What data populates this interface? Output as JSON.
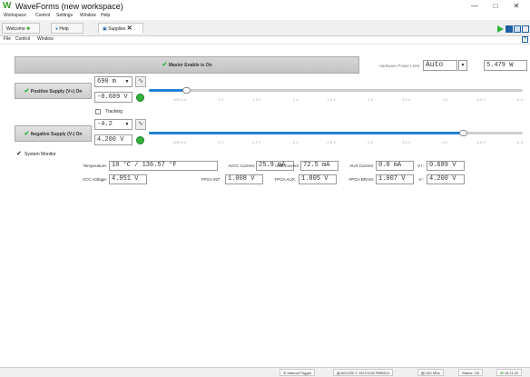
{
  "window": {
    "title": "WaveForms (new workspace)"
  },
  "main_menu": [
    "Workspace",
    "Control",
    "Settings",
    "Window",
    "Help"
  ],
  "tabs": [
    {
      "label": "Welcome"
    },
    {
      "label": "Help"
    },
    {
      "label": "Supplies"
    }
  ],
  "sub_menu": [
    "File",
    "Control",
    "Window"
  ],
  "master_enable": {
    "label": "Master Enable is On"
  },
  "hardware_limit": {
    "label": "Hardware Power Limit:",
    "mode": "Auto",
    "value": "5.479 W"
  },
  "positive_supply": {
    "button_label": "Positive Supply (V+) On",
    "current_setting": "690 m",
    "voltage": "-0.689 V",
    "slider_value": 0.5,
    "slider_max": 5,
    "ticks": [
      "500 mV",
      "1 V",
      "1.5 V",
      "2 V",
      "2.5 V",
      "3 V",
      "3.5 V",
      "4 V",
      "4.5 V",
      "5 V"
    ]
  },
  "tracking": {
    "label": "Tracking",
    "checked": false
  },
  "negative_supply": {
    "button_label": "Negative Supply (V-) On",
    "current_setting": "-4.2",
    "voltage": "4.200 V",
    "slider_value": -4.2,
    "slider_max": -5,
    "ticks": [
      "-500 mV",
      "-1 V",
      "-1.5 V",
      "-2 V",
      "-2.5 V",
      "-3 V",
      "-3.5 V",
      "-4 V",
      "-4.5 V",
      "-5 V"
    ]
  },
  "system_monitor": {
    "label": "System Monitor",
    "checked": true,
    "temperature_label": "Temperature:",
    "temperature_value": "10 °C / 136.57 °F",
    "avcc_current_label": "AVCC Current:",
    "avcc_current_value": "25.9 mA",
    "usb_current_label": "USB Current:",
    "usb_current_value": "72.5 mA",
    "aux_current_label": "AUX Current:",
    "aux_current_value": "0.0 mA",
    "vplus_label": "V+:",
    "vplus_value": "0.689 V",
    "vcc_voltage_label": "VCC Voltage:",
    "vcc_voltage_value": "4.951 V",
    "fpga_int_label": "FPGA INT:",
    "fpga_int_value": "1.008 V",
    "fpga_aux_label": "FPGA AUX:",
    "fpga_aux_value": "1.805 V",
    "fpga_bram_label": "FPGA BRAM:",
    "fpga_bram_value": "1.007 V",
    "vminus_label": "V-:",
    "vminus_value": "4.200 V"
  },
  "status_bar": {
    "manual_trigger": "Manual Trigger",
    "device": "AD2230 C SN:210417B9B011",
    "clock": "100 MHz",
    "status": "Status: OK",
    "version": "v3.21.22"
  },
  "colors": {
    "accent": "#1f7fd6",
    "on_green": "#2fb33a",
    "logo_green": "#3a9b2e"
  }
}
